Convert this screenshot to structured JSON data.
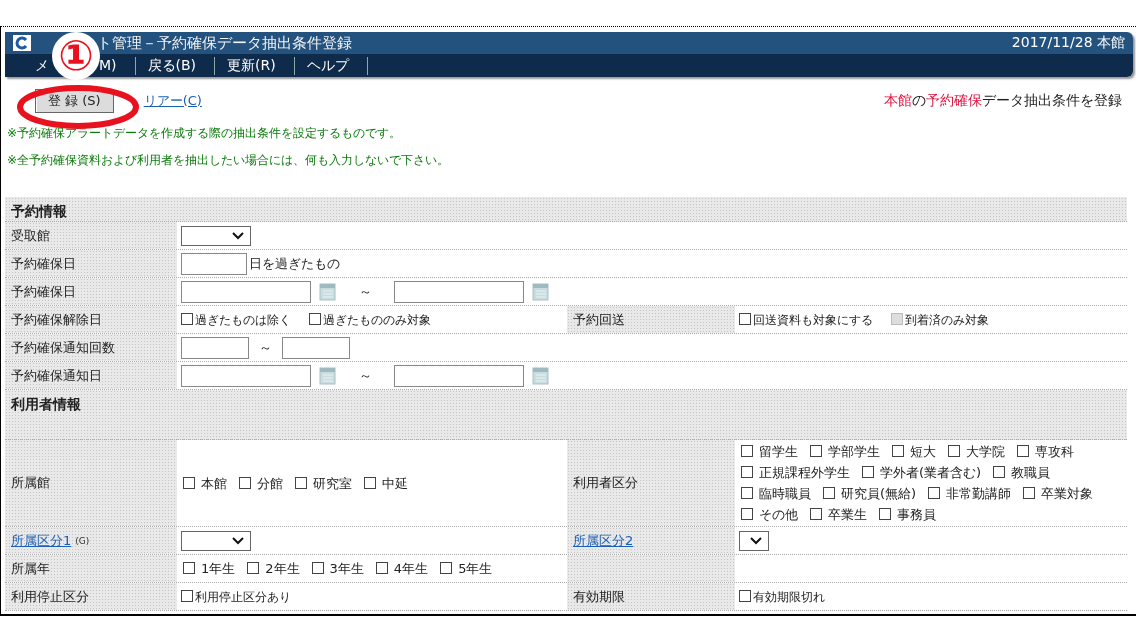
{
  "header": {
    "title": "ト管理－予約確保データ抽出条件登録",
    "date": "2017/11/28 本館",
    "menu": [
      {
        "label_start": "メ",
        "label_end": "M)"
      },
      {
        "label_start": "戻る(B)"
      },
      {
        "label_start": "更新(R)"
      },
      {
        "label_start": "ヘルプ"
      }
    ]
  },
  "annotation": {
    "marker": "①"
  },
  "toolbar": {
    "register_button": "登 録 (S)",
    "clear_link": "リアー(C)",
    "heading": [
      {
        "text": "本館",
        "highlight": true
      },
      {
        "text": "の",
        "highlight": false
      },
      {
        "text": "予約確保",
        "highlight": true
      },
      {
        "text": "データ抽出条件を登録",
        "highlight": false
      }
    ]
  },
  "notes": [
    "※予約確保アラートデータを作成する際の抽出条件を設定するものです。",
    "※全予約確保資料および利用者を抽出したい場合には、何も入力しないで下さい。"
  ],
  "sections": [
    {
      "title": "予約情報",
      "rows": [
        {
          "label": "受取館",
          "label_link": false,
          "fields": [
            {
              "kind": "select"
            }
          ]
        },
        {
          "label": "予約確保日",
          "label_link": false,
          "fields": [
            {
              "kind": "input_suffix",
              "suffix": "日を過ぎたもの"
            }
          ]
        },
        {
          "label": "予約確保日",
          "label_link": false,
          "fields": [
            {
              "kind": "date_range",
              "separator": "～"
            }
          ]
        },
        {
          "label": "予約確保解除日",
          "label_link": false,
          "fields": [
            {
              "kind": "small_checks",
              "items": [
                {
                  "label": "過ぎたものは除く",
                  "checked": false,
                  "disabled": false
                },
                {
                  "label": "過ぎたもののみ対象",
                  "checked": false,
                  "disabled": false
                }
              ]
            }
          ],
          "side": {
            "label": "予約回送",
            "label_link": false,
            "fields": [
              {
                "kind": "small_checks",
                "items": [
                  {
                    "label": "回送資料も対象にする",
                    "checked": false,
                    "disabled": false
                  },
                  {
                    "label": "到着済のみ対象",
                    "checked": false,
                    "disabled": true
                  }
                ]
              }
            ]
          }
        },
        {
          "label": "予約確保通知回数",
          "label_link": false,
          "fields": [
            {
              "kind": "count_range",
              "separator": "～"
            }
          ]
        },
        {
          "label": "予約確保通知日",
          "label_link": false,
          "fields": [
            {
              "kind": "date_range",
              "separator": "～"
            }
          ]
        }
      ]
    },
    {
      "title": "利用者情報",
      "rows": [
        {
          "label": "所属館",
          "label_link": false,
          "fields": [
            {
              "kind": "checks",
              "items": [
                {
                  "label": "本館",
                  "checked": false,
                  "disabled": false
                },
                {
                  "label": "分館",
                  "checked": false,
                  "disabled": false
                },
                {
                  "label": "研究室",
                  "checked": false,
                  "disabled": false
                },
                {
                  "label": "中延",
                  "checked": false,
                  "disabled": false
                }
              ]
            }
          ],
          "side": {
            "label": "利用者区分",
            "label_link": false,
            "fields": [
              {
                "kind": "checks",
                "items": [
                  {
                    "label": "留学生",
                    "checked": false,
                    "disabled": false
                  },
                  {
                    "label": "学部学生",
                    "checked": false,
                    "disabled": false
                  },
                  {
                    "label": "短大",
                    "checked": false,
                    "disabled": false
                  },
                  {
                    "label": "大学院",
                    "checked": false,
                    "disabled": false
                  },
                  {
                    "label": "専攻科",
                    "checked": false,
                    "disabled": false
                  },
                  {
                    "label": "正規課程外学生",
                    "checked": false,
                    "disabled": false
                  },
                  {
                    "label": "学外者(業者含む)",
                    "checked": false,
                    "disabled": false
                  },
                  {
                    "label": "教職員",
                    "checked": false,
                    "disabled": false
                  },
                  {
                    "label": "臨時職員",
                    "checked": false,
                    "disabled": false
                  },
                  {
                    "label": "研究員(無給)",
                    "checked": false,
                    "disabled": false
                  },
                  {
                    "label": "非常勤講師",
                    "checked": false,
                    "disabled": false
                  },
                  {
                    "label": "卒業対象",
                    "checked": false,
                    "disabled": false
                  },
                  {
                    "label": "その他",
                    "checked": false,
                    "disabled": false
                  },
                  {
                    "label": "卒業生",
                    "checked": false,
                    "disabled": false
                  },
                  {
                    "label": "事務員",
                    "checked": false,
                    "disabled": false
                  }
                ]
              }
            ]
          }
        },
        {
          "label": "所属区分1",
          "label_link": true,
          "label_note": "(G)",
          "fields": [
            {
              "kind": "select"
            }
          ],
          "side": {
            "label": "所属区分2",
            "label_link": true,
            "fields": [
              {
                "kind": "small_select"
              }
            ]
          }
        },
        {
          "label": "所属年",
          "label_link": false,
          "fields": [
            {
              "kind": "checks",
              "items": [
                {
                  "label": "1年生",
                  "checked": false,
                  "disabled": false
                },
                {
                  "label": "2年生",
                  "checked": false,
                  "disabled": false
                },
                {
                  "label": "3年生",
                  "checked": false,
                  "disabled": false
                },
                {
                  "label": "4年生",
                  "checked": false,
                  "disabled": false
                },
                {
                  "label": "5年生",
                  "checked": false,
                  "disabled": false
                }
              ]
            }
          ],
          "right_blank": true
        },
        {
          "label": "利用停止区分",
          "label_link": false,
          "fields": [
            {
              "kind": "small_checks",
              "items": [
                {
                  "label": "利用停止区分あり",
                  "checked": false,
                  "disabled": false
                }
              ]
            }
          ],
          "side": {
            "label": "有効期限",
            "label_link": false,
            "fields": [
              {
                "kind": "small_checks",
                "items": [
                  {
                    "label": "有効期限切れ",
                    "checked": false,
                    "disabled": false
                  }
                ]
              }
            ]
          }
        }
      ]
    }
  ]
}
